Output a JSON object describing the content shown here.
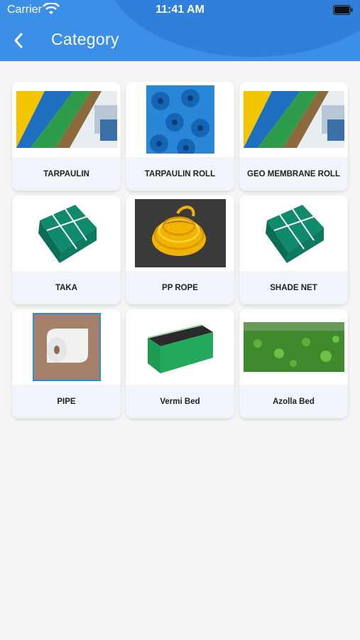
{
  "status_bar": {
    "carrier": "Carrier",
    "time": "11:41 AM"
  },
  "header": {
    "title": "Category",
    "back_icon": "chevron-left-icon"
  },
  "categories": [
    {
      "label": "TARPAULIN"
    },
    {
      "label": "TARPAULIN ROLL"
    },
    {
      "label": "GEO MEMBRANE ROLL"
    },
    {
      "label": "TAKA"
    },
    {
      "label": "PP ROPE"
    },
    {
      "label": "SHADE NET"
    },
    {
      "label": "PIPE"
    },
    {
      "label": "Vermi Bed"
    },
    {
      "label": "Azolla Bed"
    }
  ],
  "colors": {
    "header": "#3b8fe6",
    "card_footer": "#f1f5fb",
    "background": "#f5f5f6"
  }
}
